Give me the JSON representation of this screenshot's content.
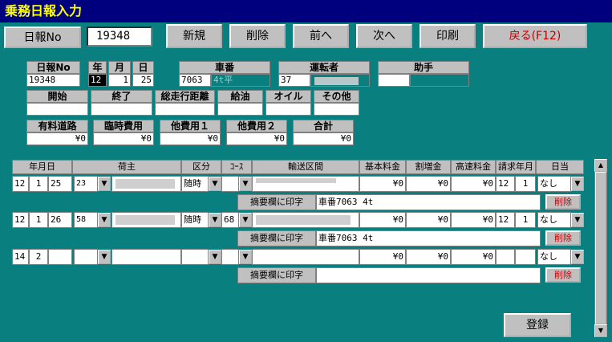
{
  "window": {
    "title": "乗務日報入力"
  },
  "toolbar": {
    "report_no_label": "日報No",
    "report_no_value": "19348",
    "new_label": "新規",
    "delete_label": "削除",
    "prev_label": "前へ",
    "next_label": "次へ",
    "print_label": "印刷",
    "back_label": "戻る(F12)"
  },
  "header": {
    "report_no_label": "日報No",
    "report_no": "19348",
    "year_label": "年",
    "year": "12",
    "month_label": "月",
    "month": "1",
    "day_label": "日",
    "day": "25",
    "car_label": "車番",
    "car_no": "7063",
    "car_type": "4t平",
    "driver_label": "運転者",
    "driver_no": "37",
    "assistant_label": "助手",
    "assistant": "",
    "start_label": "開始",
    "start": "",
    "end_label": "終了",
    "end": "",
    "distance_label": "総走行距離",
    "distance": "",
    "fuel_label": "給油",
    "fuel": "",
    "oil_label": "オイル",
    "oil": "",
    "other_label": "その他",
    "other": "",
    "toll_label": "有料道路",
    "toll": "¥0",
    "temp_label": "臨時費用",
    "temp": "¥0",
    "other1_label": "他費用１",
    "other1": "¥0",
    "other2_label": "他費用２",
    "other2": "¥0",
    "total_label": "合計",
    "total": "¥0"
  },
  "table": {
    "headers": {
      "date": "年月日",
      "shipper": "荷主",
      "category": "区分",
      "course": "ｺｰｽ",
      "route": "輸送区間",
      "base_fee": "基本料金",
      "surcharge": "割増金",
      "highway_fee": "高速料金",
      "billing_month": "請求年月",
      "overnight": "日当"
    },
    "memo_label": "摘要欄に印字",
    "row_delete_label": "削除",
    "rows": [
      {
        "m": "12",
        "d": "1",
        "day": "25",
        "shipper_code": "23",
        "category": "随時",
        "course": "",
        "base_fee": "¥0",
        "surcharge": "¥0",
        "highway_fee": "¥0",
        "bill_m": "12",
        "bill_d": "1",
        "overnight": "なし",
        "memo": "車番7063 4t"
      },
      {
        "m": "12",
        "d": "1",
        "day": "26",
        "shipper_code": "58",
        "category": "随時",
        "course": "68",
        "base_fee": "¥0",
        "surcharge": "¥0",
        "highway_fee": "¥0",
        "bill_m": "12",
        "bill_d": "1",
        "overnight": "なし",
        "memo": "車番7063 4t"
      },
      {
        "m": "14",
        "d": "2",
        "day": "",
        "shipper_code": "",
        "category": "",
        "course": "",
        "base_fee": "¥0",
        "surcharge": "¥0",
        "highway_fee": "¥0",
        "bill_m": "",
        "bill_d": "",
        "overnight": "なし",
        "memo": ""
      }
    ]
  },
  "register_label": "登録",
  "icons": {
    "dropdown": "▼",
    "scroll_up": "▲",
    "scroll_down": "▼"
  }
}
